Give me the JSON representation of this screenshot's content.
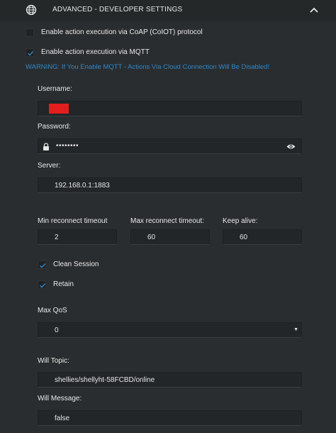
{
  "header": {
    "title": "ADVANCED - DEVELOPER SETTINGS",
    "icon": "globe-icon",
    "collapse_icon": "chevron-up-icon"
  },
  "options": {
    "coap_label": "Enable action execution via CoAP (CoIOT) protocol",
    "coap_checked": false,
    "mqtt_label": "Enable action execution via MQTT",
    "mqtt_checked": true
  },
  "warning": "WARNING: If You Enable MQTT - Actions Via Cloud Connection Will Be Disabled!",
  "form": {
    "username_label": "Username:",
    "username_value": "",
    "password_label": "Password:",
    "password_mask": "••••••••",
    "server_label": "Server:",
    "server_value": "192.168.0.1:1883",
    "min_reconnect_label": "Min reconnect timeout",
    "min_reconnect_value": "2",
    "max_reconnect_label": "Max reconnect timeout:",
    "max_reconnect_value": "60",
    "keep_alive_label": "Keep alive:",
    "keep_alive_value": "60",
    "clean_session_label": "Clean Session",
    "clean_session_checked": true,
    "retain_label": "Retain",
    "retain_checked": true,
    "max_qos_label": "Max QoS",
    "max_qos_value": "0",
    "will_topic_label": "Will Topic:",
    "will_topic_value": "shellies/shellyht-58FCBD/online",
    "will_message_label": "Will Message:",
    "will_message_value": "false"
  },
  "colors": {
    "accent": "#2f86c8",
    "background": "#2a2d2f",
    "redaction": "#e41e1e"
  }
}
